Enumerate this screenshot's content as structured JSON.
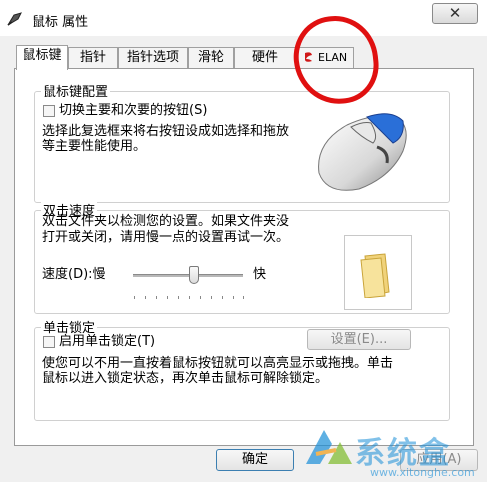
{
  "window": {
    "title": "鼠标 属性",
    "close_glyph": "✕"
  },
  "tabs": [
    {
      "label": "鼠标键"
    },
    {
      "label": "指针"
    },
    {
      "label": "指针选项"
    },
    {
      "label": "滑轮"
    },
    {
      "label": "硬件"
    },
    {
      "label": "ELAN"
    }
  ],
  "button_config": {
    "title": "鼠标键配置",
    "checkbox_label": "切换主要和次要的按钮(S)",
    "description_line1": "选择此复选框来将右按钮设成如选择和拖放",
    "description_line2": "等主要性能使用。"
  },
  "double_click": {
    "title": "双击速度",
    "description_line1": "双击文件夹以检测您的设置。如果文件夹没",
    "description_line2": "打开或关闭，请用慢一点的设置再试一次。",
    "speed_label": "速度(D):慢",
    "fast_label": "快",
    "speed_value": 0.55
  },
  "click_lock": {
    "title": "单击锁定",
    "checkbox_label": "启用单击锁定(T)",
    "settings_button": "设置(E)...",
    "description_line1": "使您可以不用一直按着鼠标按钮就可以高亮显示或拖拽。单击",
    "description_line2": "鼠标以进入锁定状态，再次单击鼠标可解除锁定。"
  },
  "footer": {
    "ok": "确定",
    "apply": "应用(A)"
  },
  "watermark": {
    "text": "系统盒",
    "url": "www.xitonghe.com"
  },
  "colors": {
    "annotation": "#e01010",
    "watermark": "#1b8fd8"
  }
}
